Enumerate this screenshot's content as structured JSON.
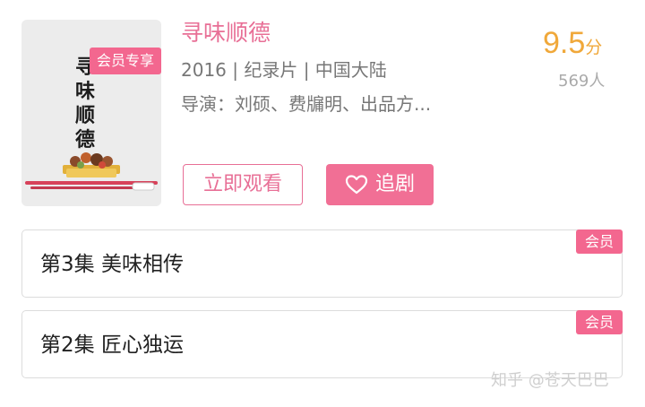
{
  "show": {
    "vip_tag": "会员专享",
    "poster_title_chars": [
      "寻",
      "味",
      "顺",
      "德"
    ],
    "title": "寻味顺德",
    "score": "9.5",
    "score_unit": "分",
    "raters": "569人",
    "meta": "2016 | 纪录片 | 中国大陆",
    "director": "导演：刘硕、费牖明、出品方..."
  },
  "actions": {
    "watch_label": "立即观看",
    "follow_label": "追剧",
    "follow_icon": "heart-outline-icon"
  },
  "episodes": [
    {
      "title": "第3集 美味相传",
      "badge": "会员"
    },
    {
      "title": "第2集 匠心独运",
      "badge": "会员"
    }
  ],
  "watermark": "知乎 @苍天巴巴",
  "colors": {
    "accent_pink": "#f3678f",
    "title_pink": "#e86f96",
    "score_orange": "#f0a83a"
  }
}
